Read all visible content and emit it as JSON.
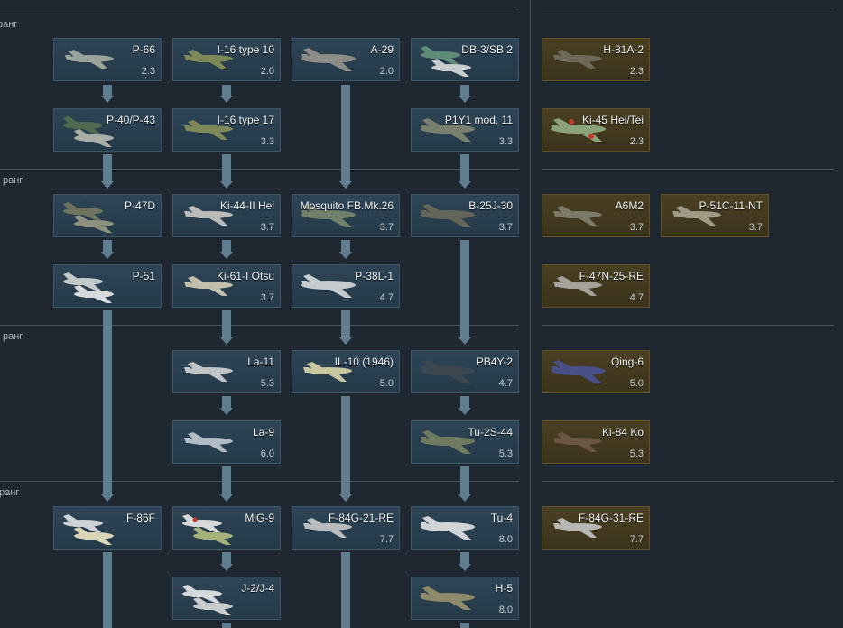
{
  "rank_label": "ранг",
  "vehicles": {
    "p66": {
      "name": "P-66",
      "br": "2.3"
    },
    "i16_10": {
      "name": "I-16 type 10",
      "br": "2.0"
    },
    "a29": {
      "name": "A-29",
      "br": "2.0"
    },
    "db3": {
      "name": "DB-3/SB 2",
      "br": ""
    },
    "h81a2": {
      "name": "H-81A-2",
      "br": "2.3"
    },
    "p40": {
      "name": "P-40/P-43",
      "br": ""
    },
    "i16_17": {
      "name": "I-16 type 17",
      "br": "3.3"
    },
    "p1y1": {
      "name": "P1Y1 mod. 11",
      "br": "3.3"
    },
    "ki45": {
      "name": "Ki-45 Hei/Tei",
      "br": "2.3"
    },
    "p47d": {
      "name": "P-47D",
      "br": ""
    },
    "ki44": {
      "name": "Ki-44-II Hei",
      "br": "3.7"
    },
    "mosquito": {
      "name": "Mosquito FB.Mk.26",
      "br": "3.7"
    },
    "b25": {
      "name": "B-25J-30",
      "br": "3.7"
    },
    "a6m2": {
      "name": "A6M2",
      "br": "3.7"
    },
    "p51c": {
      "name": "P-51C-11-NT",
      "br": "3.7"
    },
    "p51": {
      "name": "P-51",
      "br": ""
    },
    "ki61": {
      "name": "Ki-61-I Otsu",
      "br": "3.7"
    },
    "p38": {
      "name": "P-38L-1",
      "br": "4.7"
    },
    "f47n": {
      "name": "F-47N-25-RE",
      "br": "4.7"
    },
    "la11": {
      "name": "La-11",
      "br": "5.3"
    },
    "il10": {
      "name": "IL-10 (1946)",
      "br": "5.0"
    },
    "pb4y": {
      "name": "PB4Y-2",
      "br": "4.7"
    },
    "qing6": {
      "name": "Qing-6",
      "br": "5.0"
    },
    "la9": {
      "name": "La-9",
      "br": "6.0"
    },
    "tu2s": {
      "name": "Tu-2S-44",
      "br": "5.3"
    },
    "ki84": {
      "name": "Ki-84 Ko",
      "br": "5.3"
    },
    "f86f": {
      "name": "F-86F",
      "br": ""
    },
    "mig9": {
      "name": "MiG-9",
      "br": ""
    },
    "f84g21": {
      "name": "F-84G-21-RE",
      "br": "7.7"
    },
    "tu4": {
      "name": "Tu-4",
      "br": "8.0"
    },
    "f84g31": {
      "name": "F-84G-31-RE",
      "br": "7.7"
    },
    "j2": {
      "name": "J-2/J-4",
      "br": ""
    },
    "h5": {
      "name": "H-5",
      "br": "8.0"
    }
  },
  "colors": {
    "background": "#1f2830",
    "card": "#2e4556",
    "premium_card": "#4a3f22",
    "connector": "#607d8f"
  }
}
